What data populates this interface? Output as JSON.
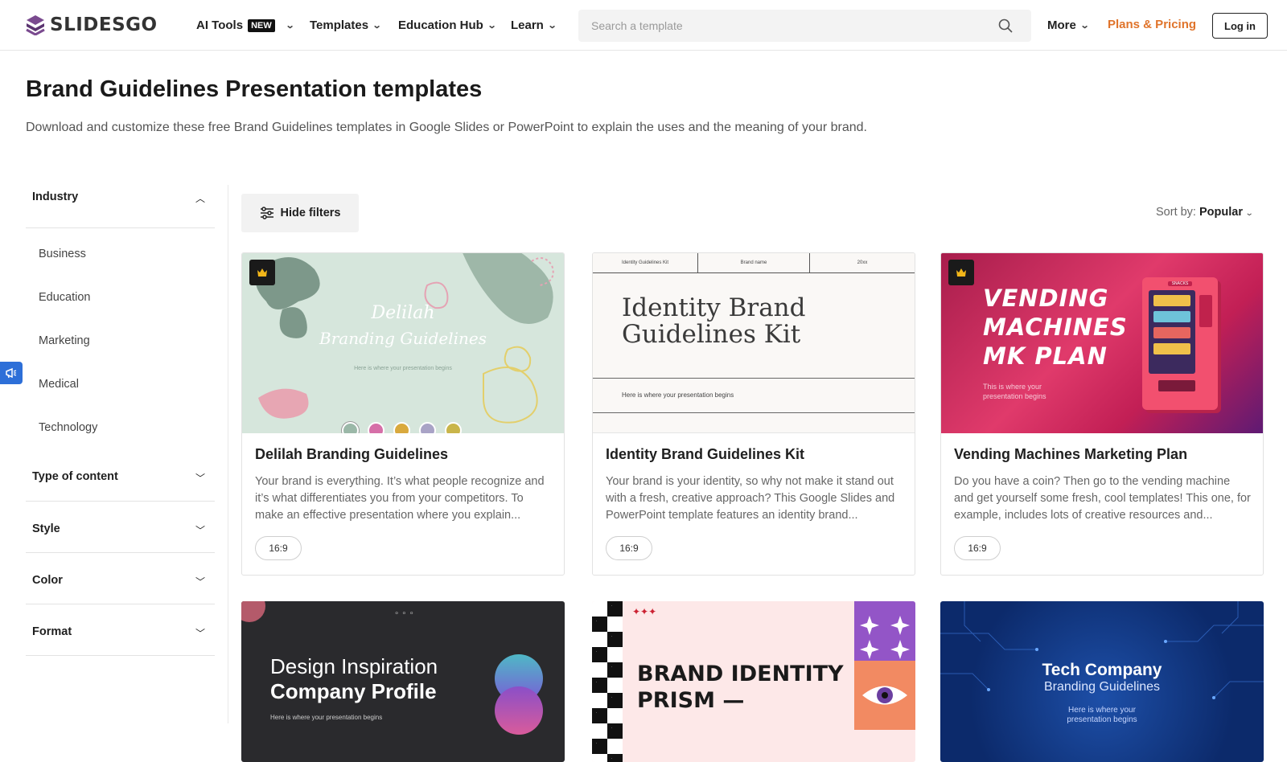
{
  "header": {
    "logo_text": "SLIDESGO",
    "nav": {
      "ai_tools": "AI Tools",
      "new_badge": "NEW",
      "templates": "Templates",
      "education_hub": "Education Hub",
      "learn": "Learn",
      "more": "More"
    },
    "search_placeholder": "Search a template",
    "pricing": "Plans & Pricing",
    "login": "Log in"
  },
  "page": {
    "title": "Brand Guidelines Presentation templates",
    "description": "Download and customize these free Brand Guidelines templates in Google Slides or PowerPoint to explain the uses and the meaning of your brand."
  },
  "sidebar": {
    "industry": {
      "label": "Industry",
      "items": [
        "Business",
        "Education",
        "Marketing",
        "Medical",
        "Technology"
      ]
    },
    "type_of_content": "Type of content",
    "style": "Style",
    "color": "Color",
    "format": "Format"
  },
  "toolbar": {
    "hide_filters": "Hide filters",
    "sort_label": "Sort by:",
    "sort_value": "Popular"
  },
  "cards": [
    {
      "title": "Delilah Branding Guidelines",
      "description": "Your brand is everything. It’s what people recognize and it’s what differentiates you from your competitors. To make an effective presentation where you explain...",
      "ratio": "16:9",
      "thumb_title_1": "Delilah",
      "thumb_title_2": "Branding Guidelines",
      "thumb_sub": "Here is where your presentation begins",
      "swatches": [
        "#9bb8a8",
        "#d66fa8",
        "#d9a93d",
        "#a9a3c6",
        "#c9b54a"
      ]
    },
    {
      "title": "Identity Brand Guidelines Kit",
      "description": "Your brand is your identity, so why not make it stand out with a fresh, creative approach? This Google Slides and PowerPoint template features an identity brand...",
      "ratio": "16:9",
      "thumb_col_1": "Identity Guidelines Kit",
      "thumb_col_2": "Brand name",
      "thumb_col_3": "20xx",
      "thumb_title_1": "Identity Brand",
      "thumb_title_2": "Guidelines Kit",
      "thumb_sub": "Here is where your presentation begins"
    },
    {
      "title": "Vending Machines Marketing Plan",
      "description": "Do you have a coin? Then go to the vending machine and get yourself some fresh, cool templates! This one, for example, includes lots of creative resources and...",
      "ratio": "16:9",
      "thumb_title_1": "VENDING",
      "thumb_title_2": "MACHINES",
      "thumb_title_3": "MK PLAN",
      "thumb_sub_1": "This is where your",
      "thumb_sub_2": "presentation begins",
      "machine_label": "SNACKS"
    }
  ],
  "cards_row2": [
    {
      "thumb_title_1": "Design Inspiration",
      "thumb_title_2": "Company Profile",
      "thumb_sub": "Here is where your presentation begins"
    },
    {
      "thumb_title_1": "BRAND IDENTITY",
      "thumb_title_2": "PRISM —"
    },
    {
      "thumb_title_1": "Tech Company",
      "thumb_title_2": "Branding Guidelines",
      "thumb_sub_1": "Here is where your",
      "thumb_sub_2": "presentation begins"
    }
  ]
}
